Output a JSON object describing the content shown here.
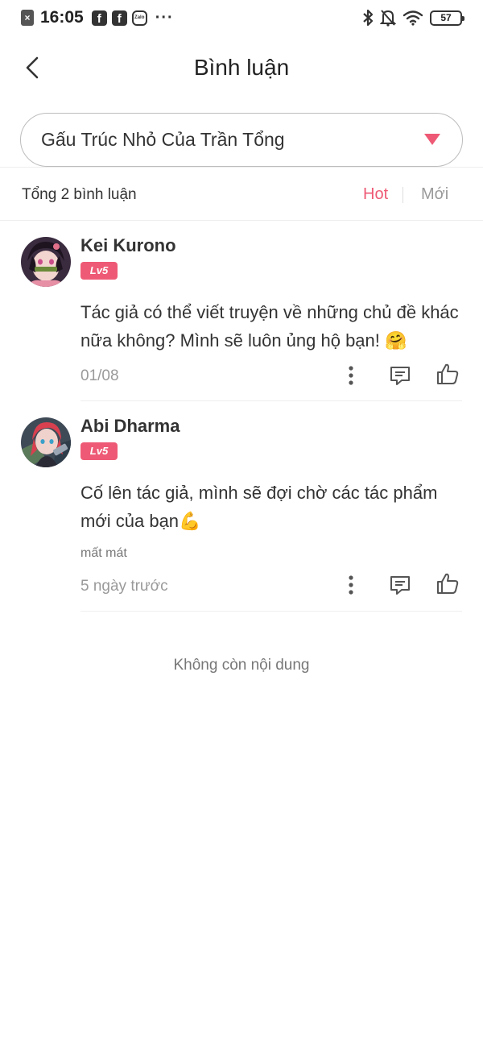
{
  "status_bar": {
    "time": "16:05",
    "battery": "57",
    "left_icons": [
      "notification-x-icon",
      "facebook-icon",
      "facebook-icon",
      "zalo-icon",
      "more-dots-icon"
    ],
    "right_icons": [
      "bluetooth-icon",
      "bell-off-icon",
      "wifi-icon",
      "battery-icon"
    ]
  },
  "header": {
    "title": "Bình luận"
  },
  "selector": {
    "value": "Gấu Trúc Nhỏ Của Trần Tổng"
  },
  "sort": {
    "total_label": "Tổng 2 bình luận",
    "hot_label": "Hot",
    "new_label": "Mới"
  },
  "comments": [
    {
      "username": "Kei Kurono",
      "level": "Lv5",
      "text": "Tác giả có thể viết truyện về những chủ đề khác nữa không? Mình sẽ luôn ủng hộ bạn! 🤗",
      "sub_note": "",
      "date": "01/08"
    },
    {
      "username": "Abi Dharma",
      "level": "Lv5",
      "text": "Cố lên tác giả, mình sẽ đợi chờ các tác phẩm mới của bạn💪",
      "sub_note": "mất mát",
      "date": "5 ngày trước"
    }
  ],
  "footer": {
    "no_more": "Không còn nội dung"
  },
  "colors": {
    "accent": "#ee5a75",
    "text": "#333333",
    "muted": "#9a9a9a",
    "divider": "#eeeeee"
  }
}
